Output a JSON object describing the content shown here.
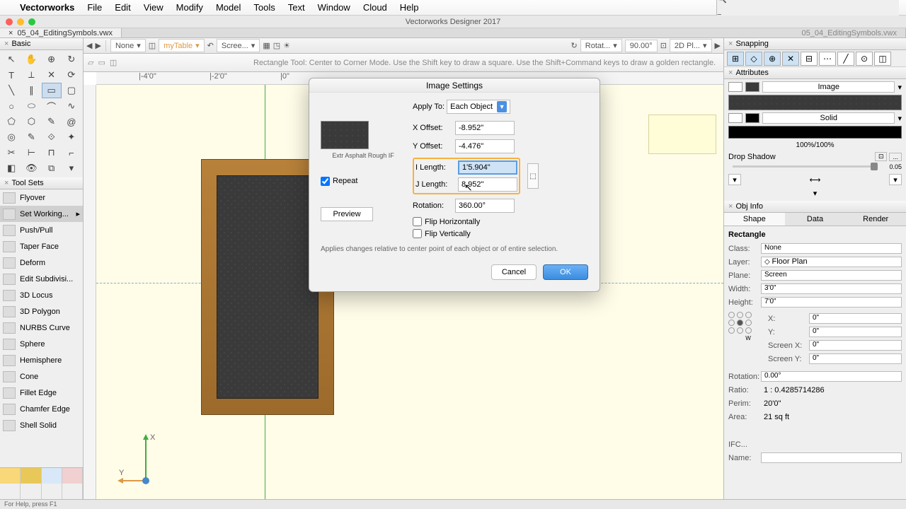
{
  "menubar": {
    "app": "Vectorworks",
    "items": [
      "File",
      "Edit",
      "View",
      "Modify",
      "Model",
      "Tools",
      "Text",
      "Window",
      "Cloud",
      "Help"
    ]
  },
  "titlebar": {
    "title": "Vectorworks Designer 2017"
  },
  "tabbar": {
    "active": "05_04_EditingSymbols.vwx",
    "inactive": "05_04_EditingSymbols.vwx"
  },
  "doc_tab": {
    "label": "05_04_EditingSymbols.vwx"
  },
  "toolbar1": {
    "none": "None",
    "myTable": "myTable",
    "scree": "Scree...",
    "rotat": "Rotat...",
    "ang": "90.00°",
    "pl2d": "2D Pl..."
  },
  "toolbar2": {
    "hint": "Rectangle Tool: Center to Corner Mode. Use the Shift key to draw a square. Use the Shift+Command keys to draw a golden rectangle."
  },
  "left": {
    "basic": "Basic",
    "toolsets": "Tool Sets",
    "sets": [
      "Flyover",
      "Set Working...",
      "Push/Pull",
      "Taper Face",
      "Deform",
      "Edit Subdivisi...",
      "3D Locus",
      "3D Polygon",
      "NURBS Curve",
      "Sphere",
      "Hemisphere",
      "Cone",
      "Fillet Edge",
      "Chamfer Edge",
      "Shell Solid"
    ]
  },
  "snapping": {
    "title": "Snapping"
  },
  "attributes": {
    "title": "Attributes",
    "image": "Image",
    "solid": "Solid",
    "pct": "100%/100%",
    "shadow": "Drop Shadow",
    "slider": "0.05"
  },
  "objinfo": {
    "title": "Obj Info",
    "tabs": [
      "Shape",
      "Data",
      "Render"
    ],
    "type": "Rectangle",
    "class_lbl": "Class:",
    "class_v": "None",
    "layer_lbl": "Layer:",
    "layer_v": "Floor Plan",
    "plane_lbl": "Plane:",
    "plane_v": "Screen",
    "width_lbl": "Width:",
    "width_v": "3'0\"",
    "height_lbl": "Height:",
    "height_v": "7'0\"",
    "x_lbl": "X:",
    "x_v": "0\"",
    "y_lbl": "Y:",
    "y_v": "0\"",
    "sx_lbl": "Screen X:",
    "sx_v": "0\"",
    "sy_lbl": "Screen Y:",
    "sy_v": "0\"",
    "rot_lbl": "Rotation:",
    "rot_v": "0.00°",
    "ratio_lbl": "Ratio:",
    "ratio_v": "1 : 0.4285714286",
    "perim_lbl": "Perim:",
    "perim_v": "20'0\"",
    "area_lbl": "Area:",
    "area_v": "21 sq ft",
    "ifc_lbl": "IFC...",
    "name_lbl": "Name:"
  },
  "dialog": {
    "title": "Image Settings",
    "apply_to_lbl": "Apply To:",
    "apply_to": "Each Object",
    "thumb_name": "Extr Asphalt Rough IF",
    "repeat": "Repeat",
    "preview": "Preview",
    "xoff_lbl": "X Offset:",
    "xoff": "-8.952\"",
    "yoff_lbl": "Y Offset:",
    "yoff": "-4.476\"",
    "ilen_lbl": "I Length:",
    "ilen": "1'5.904\"",
    "jlen_lbl": "J Length:",
    "jlen": "8.952\"",
    "rot_lbl": "Rotation:",
    "rot": "360.00°",
    "fliph": "Flip Horizontally",
    "flipv": "Flip Vertically",
    "note": "Applies changes relative to center point of each object or of entire selection.",
    "cancel": "Cancel",
    "ok": "OK"
  },
  "status": "For Help, press F1"
}
